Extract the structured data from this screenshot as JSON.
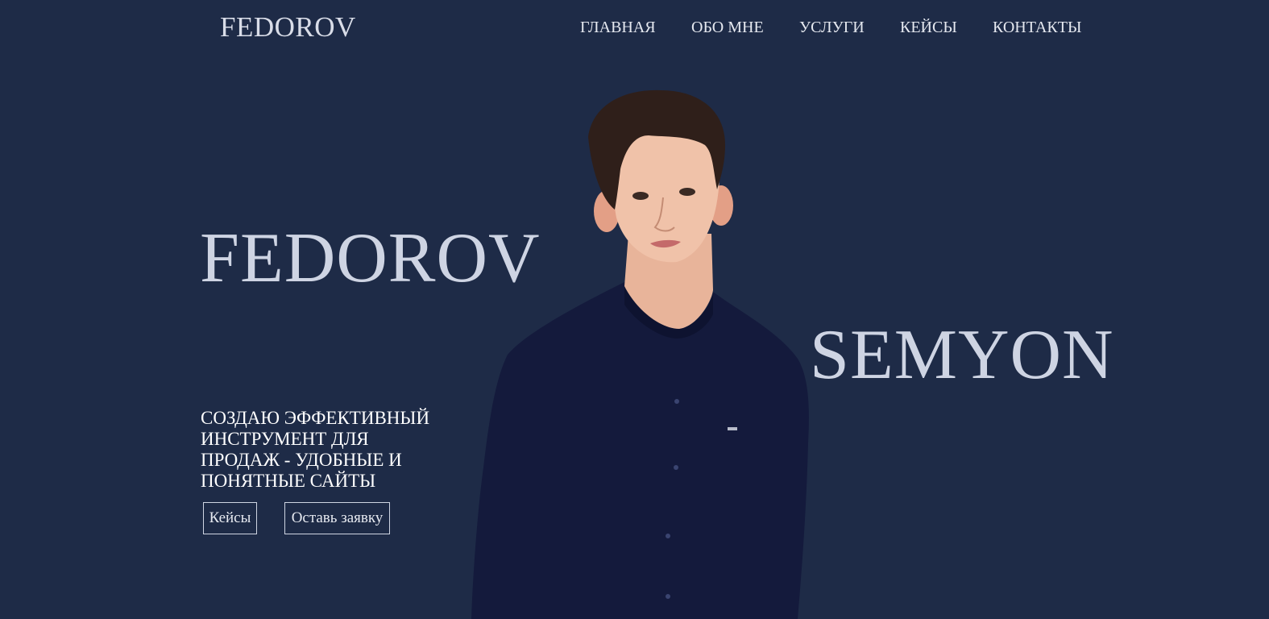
{
  "header": {
    "logo": "FEDOROV",
    "nav": [
      {
        "label": "ГЛАВНАЯ"
      },
      {
        "label": "ОБО МНЕ"
      },
      {
        "label": "УСЛУГИ"
      },
      {
        "label": "КЕЙСЫ"
      },
      {
        "label": "КОНТАКТЫ"
      }
    ]
  },
  "hero": {
    "last_name": "FEDOROV",
    "first_name": "SEMYON",
    "tagline": "СОЗДАЮ ЭФФЕКТИВНЫЙ ИНСТРУМЕНТ ДЛЯ ПРОДАЖ - УДОБНЫЕ И ПОНЯТНЫЕ САЙТЫ",
    "buttons": {
      "cases": "Кейсы",
      "apply": "Оставь заявку"
    }
  },
  "colors": {
    "background": "#1e2b47",
    "text": "#d9dde8",
    "shirt": "#141a3c"
  }
}
